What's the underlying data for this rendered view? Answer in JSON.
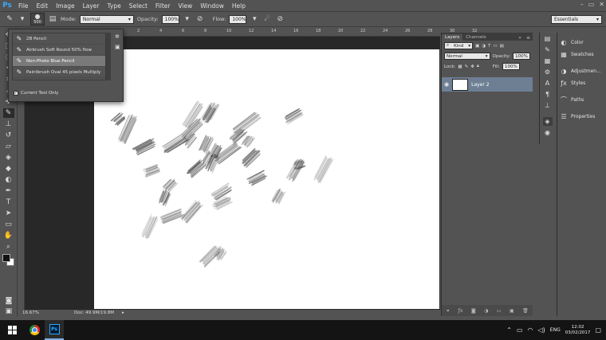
{
  "app": {
    "logo": "Ps"
  },
  "menu": [
    "File",
    "Edit",
    "Image",
    "Layer",
    "Type",
    "Select",
    "Filter",
    "View",
    "Window",
    "Help"
  ],
  "window_buttons": {
    "minimize": "–",
    "restore": "▭",
    "close": "✕"
  },
  "options_bar": {
    "brush_size": "500",
    "mode_label": "Mode:",
    "mode_value": "Normal",
    "opacity_label": "Opacity:",
    "opacity_value": "100%",
    "flow_label": "Flow:",
    "flow_value": "100%",
    "workspace": "Essentials"
  },
  "ruler": {
    "top_ticks": [
      "2",
      "0",
      "2",
      "4",
      "6",
      "8",
      "10",
      "12",
      "14",
      "16",
      "18",
      "20",
      "22",
      "24",
      "26",
      "28",
      "30",
      "32"
    ]
  },
  "brush_presets": {
    "items": [
      {
        "label": "2B Pencil",
        "selected": false
      },
      {
        "label": "Airbrush Soft Round 50% flow",
        "selected": false
      },
      {
        "label": "Non-Photo Blue Pencil",
        "selected": true
      },
      {
        "label": "Paintbrush Oval 45 pixels Multiply",
        "selected": false
      }
    ],
    "current_tool_only_label": "Current Tool Only",
    "current_tool_only_checked": true
  },
  "status": {
    "zoom": "16.67%",
    "doc": "Doc: 49.9M/19.8M"
  },
  "layers_panel": {
    "tabs": [
      {
        "label": "Layers",
        "active": true
      },
      {
        "label": "Channels",
        "active": false
      }
    ],
    "filter_kind": "Kind",
    "blend_mode": "Normal",
    "opacity_label": "Opacity:",
    "opacity_value": "100%",
    "lock_label": "Lock:",
    "fill_label": "Fill:",
    "fill_value": "100%",
    "layers": [
      {
        "name": "Layer 2",
        "visible": true
      }
    ]
  },
  "right_panels": {
    "group1": [
      "Color",
      "Swatches"
    ],
    "group2": [
      "Adjustmen...",
      "Styles"
    ],
    "group3": [
      "Paths"
    ],
    "group4": [
      "Properties"
    ]
  },
  "taskbar": {
    "language": "ENG",
    "time": "12:02",
    "date": "03/02/2017"
  },
  "colors": {
    "ui_panel": "#535353",
    "workspace": "#282828",
    "canvas": "#ffffff",
    "selection_blue": "#6e7f94",
    "foreground": "#111111",
    "background": "#ffffff"
  }
}
